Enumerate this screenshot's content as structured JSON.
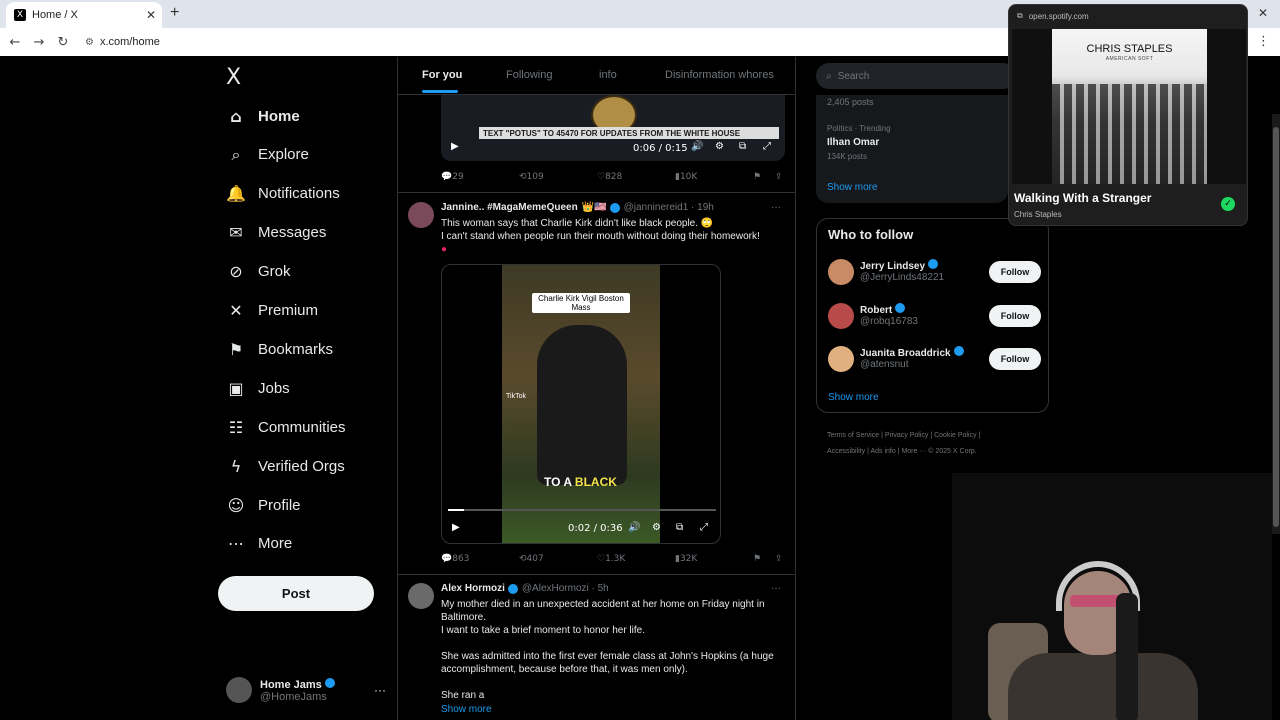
{
  "browser": {
    "tab_title": "Home / X",
    "tab_favicon": "X",
    "url": "x.com/home"
  },
  "nav": {
    "logo": "X",
    "items": [
      {
        "label": "Home",
        "icon": "home-icon",
        "glyph": "⌂"
      },
      {
        "label": "Explore",
        "icon": "search-icon",
        "glyph": "⌕"
      },
      {
        "label": "Notifications",
        "icon": "bell-icon",
        "glyph": "🔔"
      },
      {
        "label": "Messages",
        "icon": "mail-icon",
        "glyph": "✉"
      },
      {
        "label": "Grok",
        "icon": "grok-icon",
        "glyph": "⊘"
      },
      {
        "label": "Premium",
        "icon": "x-icon",
        "glyph": "✕"
      },
      {
        "label": "Bookmarks",
        "icon": "bookmark-icon",
        "glyph": "⚑"
      },
      {
        "label": "Jobs",
        "icon": "briefcase-icon",
        "glyph": "▣"
      },
      {
        "label": "Communities",
        "icon": "people-icon",
        "glyph": "☷"
      },
      {
        "label": "Verified Orgs",
        "icon": "lightning-icon",
        "glyph": "ϟ"
      },
      {
        "label": "Profile",
        "icon": "person-icon",
        "glyph": "☺"
      },
      {
        "label": "More",
        "icon": "more-circle-icon",
        "glyph": "⋯"
      }
    ],
    "post_label": "Post",
    "account": {
      "name": "Home Jams",
      "handle": "@HomeJams"
    }
  },
  "feed": {
    "tabs": [
      "For you",
      "Following",
      "info",
      "Disinformation whores"
    ],
    "tweet1": {
      "banner": "TEXT \"POTUS\" TO 45470 FOR UPDATES FROM THE WHITE HOUSE",
      "time": "0:06 / 0:15",
      "replies": "29",
      "reposts": "109",
      "likes": "828",
      "views": "10K"
    },
    "tweet2": {
      "name": "Jannine.. #MagaMemeQueen",
      "flags": "👑🇺🇸",
      "handle": "@janninereid1 · 19h",
      "text1": "This woman says that Charlie Kirk didn't like black people. 🙄",
      "text2": "I can't stand when people run their mouth without doing their homework!",
      "caption": "Charlie Kirk Vigil Boston Mass",
      "overlay_a": "TO A",
      "overlay_b": "BLACK",
      "tiktok": "TikTok",
      "time": "0:02 / 0:36",
      "progress": 0.06,
      "replies": "863",
      "reposts": "407",
      "likes": "1.3K",
      "views": "32K"
    },
    "tweet3": {
      "name": "Alex Hormozi",
      "handle": "@AlexHormozi · 5h",
      "text1": "My mother died in an unexpected accident at her home on Friday night in Baltimore.",
      "text2": "I want to take a brief moment to honor her life.",
      "text3": "She was admitted into the first ever female class at John's Hopkins (a huge accomplishment, because before that, it was men only).",
      "text4": "She ran a",
      "show_more": "Show more"
    }
  },
  "right": {
    "search_placeholder": "Search",
    "trend_posts": "2,405 posts",
    "trend_category": "Politics · Trending",
    "trend_name": "Ilhan Omar",
    "trend_count": "134K posts",
    "show_more": "Show more",
    "who_title": "Who to follow",
    "who": [
      {
        "name": "Jerry Lindsey",
        "handle": "@JerryLinds48221"
      },
      {
        "name": "Robert",
        "handle": "@robq16783"
      },
      {
        "name": "Juanita Broaddrick",
        "handle": "@atensnut"
      }
    ],
    "follow_label": "Follow",
    "footer_line1": "Terms of Service  |  Privacy Policy  |  Cookie Policy  |",
    "footer_line2": "Accessibility  |  Ads info  |  More ···  © 2025 X Corp."
  },
  "spotify": {
    "url": "open.spotify.com",
    "artist_art": "CHRIS STAPLES",
    "album_art": "AMERICAN SOFT",
    "track": "Walking With a Stranger",
    "artist": "Chris Staples"
  },
  "colors": {
    "accent": "#1d9bf0",
    "spotify_green": "#1ed760",
    "border": "#2f3336"
  }
}
